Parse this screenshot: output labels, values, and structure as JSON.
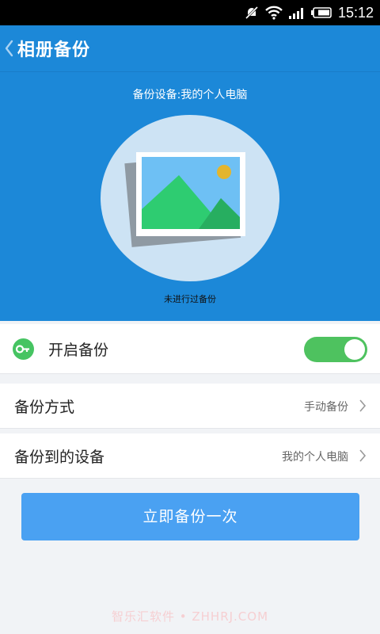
{
  "status_bar": {
    "time": "15:12",
    "icons": [
      "mute-icon",
      "wifi-icon",
      "signal-icon",
      "battery-icon"
    ]
  },
  "appbar": {
    "title": "相册备份",
    "back_icon": "chevron-left-icon"
  },
  "hero": {
    "device_label": "备份设备:我的个人电脑",
    "status": "未进行过备份",
    "illustration": "photo-icon"
  },
  "settings": {
    "enable_backup": {
      "label": "开启备份",
      "enabled": true,
      "icon": "key-icon"
    },
    "backup_mode": {
      "label": "备份方式",
      "value": "手动备份"
    },
    "backup_device": {
      "label": "备份到的设备",
      "value": "我的个人电脑"
    }
  },
  "actions": {
    "backup_now_label": "立即备份一次"
  },
  "watermark": "智乐汇软件 • ZHHRJ.COM",
  "colors": {
    "primary": "#1c88d8",
    "button": "#4aa1f2",
    "toggle_on": "#4ec25f",
    "background": "#f1f3f6"
  }
}
